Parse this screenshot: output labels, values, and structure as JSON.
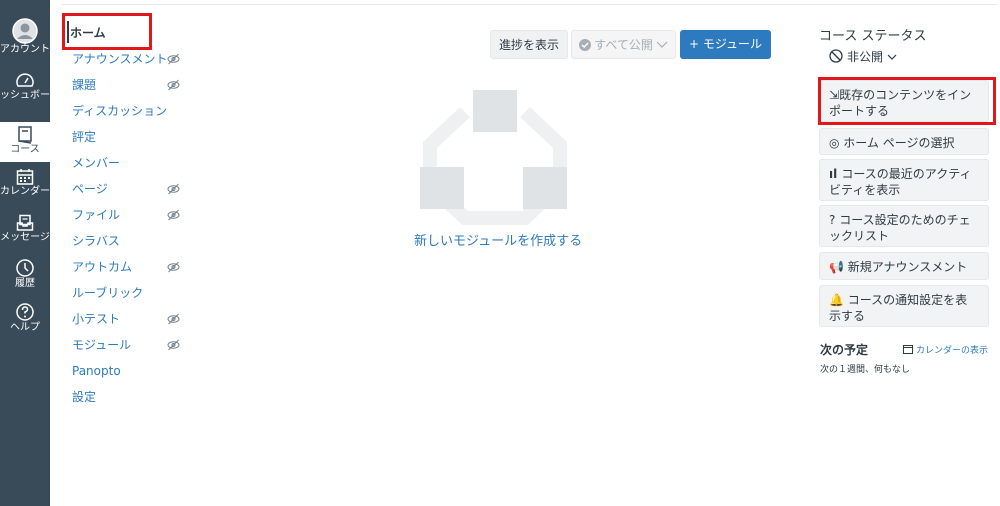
{
  "global_nav": {
    "items": [
      {
        "id": "account",
        "label": "アカウント",
        "icon": "avatar-icon"
      },
      {
        "id": "dashboard",
        "label": "ダッシュボード",
        "icon": "dashboard-icon"
      },
      {
        "id": "courses",
        "label": "コース",
        "icon": "book-icon"
      },
      {
        "id": "calendar",
        "label": "カレンダー",
        "icon": "calendar-icon"
      },
      {
        "id": "inbox",
        "label": "メッセージ",
        "icon": "inbox-icon"
      },
      {
        "id": "history",
        "label": "履歴",
        "icon": "clock-icon"
      },
      {
        "id": "help",
        "label": "ヘルプ",
        "icon": "help-icon"
      }
    ]
  },
  "course_nav": {
    "items": [
      {
        "label": "ホーム",
        "hidden": false
      },
      {
        "label": "アナウンスメント",
        "hidden": true
      },
      {
        "label": "課題",
        "hidden": true
      },
      {
        "label": "ディスカッション",
        "hidden": false
      },
      {
        "label": "評定",
        "hidden": false
      },
      {
        "label": "メンバー",
        "hidden": false
      },
      {
        "label": "ページ",
        "hidden": true
      },
      {
        "label": "ファイル",
        "hidden": true
      },
      {
        "label": "シラバス",
        "hidden": false
      },
      {
        "label": "アウトカム",
        "hidden": true
      },
      {
        "label": "ルーブリック",
        "hidden": false
      },
      {
        "label": "小テスト",
        "hidden": true
      },
      {
        "label": "モジュール",
        "hidden": true
      },
      {
        "label": "Panopto",
        "hidden": false
      },
      {
        "label": "設定",
        "hidden": false
      }
    ]
  },
  "toolbar": {
    "progress_label": "進捗を表示",
    "publish_all_label": "すべて公開",
    "add_module_label": "+ モジュール"
  },
  "main": {
    "empty_link": "新しいモジュールを作成する"
  },
  "sidebar": {
    "status_title": "コース ステータス",
    "status_value": "非公開",
    "buttons": [
      {
        "label": "既存のコンテンツをインポートする",
        "icon": "import-icon"
      },
      {
        "label": "ホーム ページの選択",
        "icon": "target-icon"
      },
      {
        "label": "コースの最近のアクティビティを表示",
        "icon": "bar-chart-icon"
      },
      {
        "label": "コース設定のためのチェックリスト",
        "icon": "question-icon"
      },
      {
        "label": "新規アナウンスメント",
        "icon": "megaphone-icon"
      },
      {
        "label": "コースの通知設定を表示する",
        "icon": "bell-icon"
      }
    ],
    "todo_title": "次の予定",
    "calendar_link": "カレンダーの表示",
    "todo_note": "次の１週間、何もなし"
  },
  "colors": {
    "nav_bg": "#394b58",
    "link": "#2d7abe",
    "primary_button": "#2d7abe",
    "highlight_box": "#e0181b"
  }
}
